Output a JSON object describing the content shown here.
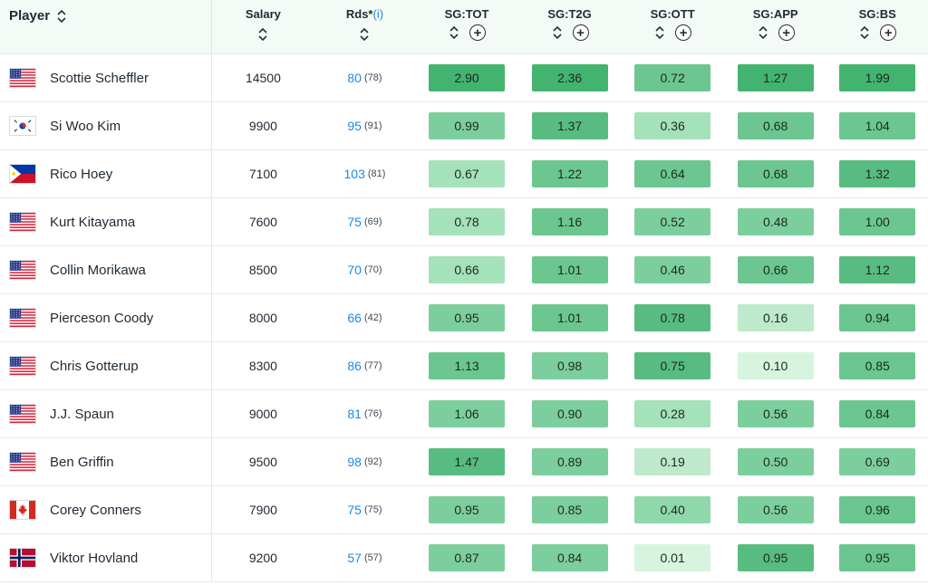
{
  "header": {
    "player": "Player",
    "salary": "Salary",
    "rds": "Rds*",
    "rds_info": "(i)",
    "sg_columns": [
      "SG:TOT",
      "SG:T2G",
      "SG:OTT",
      "SG:APP",
      "SG:BS"
    ]
  },
  "colors": {
    "sg_scale": [
      "#d7f4df",
      "#bfe9cc",
      "#a5e1b9",
      "#8fd8aa",
      "#7ccf9c",
      "#6cc690",
      "#58bc80",
      "#42b46f"
    ],
    "link_blue": "#1e88e5"
  },
  "rows": [
    {
      "flag": "usa",
      "name": "Scottie Scheffler",
      "salary": "14500",
      "rds": "80",
      "rds_sub": "(78)",
      "sg": [
        "2.90",
        "2.36",
        "0.72",
        "1.27",
        "1.99"
      ],
      "sg_level": [
        7,
        7,
        5,
        7,
        7
      ]
    },
    {
      "flag": "korea",
      "name": "Si Woo Kim",
      "salary": "9900",
      "rds": "95",
      "rds_sub": "(91)",
      "sg": [
        "0.99",
        "1.37",
        "0.36",
        "0.68",
        "1.04"
      ],
      "sg_level": [
        4,
        6,
        2,
        5,
        5
      ]
    },
    {
      "flag": "philippines",
      "name": "Rico Hoey",
      "salary": "7100",
      "rds": "103",
      "rds_sub": "(81)",
      "sg": [
        "0.67",
        "1.22",
        "0.64",
        "0.68",
        "1.32"
      ],
      "sg_level": [
        2,
        5,
        5,
        5,
        6
      ]
    },
    {
      "flag": "usa",
      "name": "Kurt Kitayama",
      "salary": "7600",
      "rds": "75",
      "rds_sub": "(69)",
      "sg": [
        "0.78",
        "1.16",
        "0.52",
        "0.48",
        "1.00"
      ],
      "sg_level": [
        2,
        5,
        4,
        4,
        5
      ]
    },
    {
      "flag": "usa",
      "name": "Collin Morikawa",
      "salary": "8500",
      "rds": "70",
      "rds_sub": "(70)",
      "sg": [
        "0.66",
        "1.01",
        "0.46",
        "0.66",
        "1.12"
      ],
      "sg_level": [
        2,
        5,
        4,
        5,
        6
      ]
    },
    {
      "flag": "usa",
      "name": "Pierceson Coody",
      "salary": "8000",
      "rds": "66",
      "rds_sub": "(42)",
      "sg": [
        "0.95",
        "1.01",
        "0.78",
        "0.16",
        "0.94"
      ],
      "sg_level": [
        4,
        5,
        6,
        1,
        5
      ]
    },
    {
      "flag": "usa",
      "name": "Chris Gotterup",
      "salary": "8300",
      "rds": "86",
      "rds_sub": "(77)",
      "sg": [
        "1.13",
        "0.98",
        "0.75",
        "0.10",
        "0.85"
      ],
      "sg_level": [
        5,
        4,
        6,
        0,
        5
      ]
    },
    {
      "flag": "usa",
      "name": "J.J. Spaun",
      "salary": "9000",
      "rds": "81",
      "rds_sub": "(76)",
      "sg": [
        "1.06",
        "0.90",
        "0.28",
        "0.56",
        "0.84"
      ],
      "sg_level": [
        4,
        4,
        2,
        4,
        5
      ]
    },
    {
      "flag": "usa",
      "name": "Ben Griffin",
      "salary": "9500",
      "rds": "98",
      "rds_sub": "(92)",
      "sg": [
        "1.47",
        "0.89",
        "0.19",
        "0.50",
        "0.69"
      ],
      "sg_level": [
        6,
        4,
        1,
        4,
        4
      ]
    },
    {
      "flag": "canada",
      "name": "Corey Conners",
      "salary": "7900",
      "rds": "75",
      "rds_sub": "(75)",
      "sg": [
        "0.95",
        "0.85",
        "0.40",
        "0.56",
        "0.96"
      ],
      "sg_level": [
        4,
        4,
        3,
        4,
        5
      ]
    },
    {
      "flag": "norway",
      "name": "Viktor Hovland",
      "salary": "9200",
      "rds": "57",
      "rds_sub": "(57)",
      "sg": [
        "0.87",
        "0.84",
        "0.01",
        "0.95",
        "0.95"
      ],
      "sg_level": [
        4,
        4,
        0,
        6,
        5
      ]
    }
  ]
}
